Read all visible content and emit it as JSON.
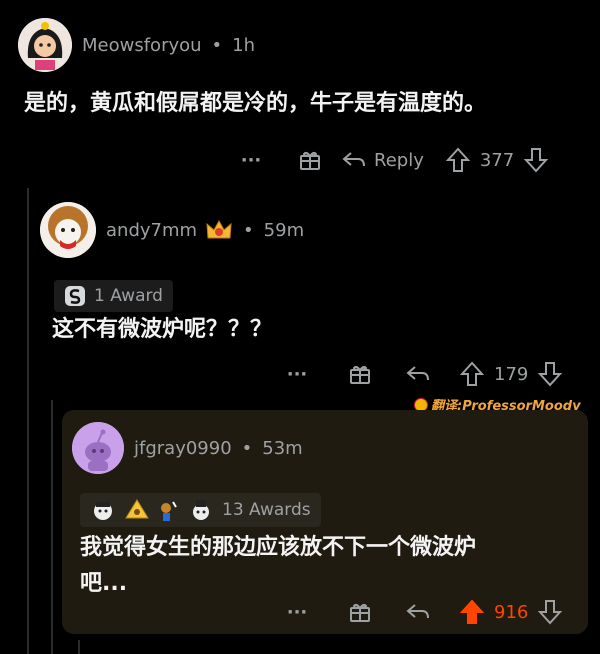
{
  "comments": [
    {
      "username": "Meowsforyou",
      "time": "1h",
      "text": "是的，黄瓜和假屌都是冷的，牛子是有温度的。",
      "actions": {
        "more": "···",
        "reply_label": "Reply",
        "score": "377"
      }
    },
    {
      "username": "andy7mm",
      "time": "59m",
      "award_label": "1 Award",
      "text": "这不有微波炉呢？？？",
      "actions": {
        "more": "···",
        "score": "179"
      }
    },
    {
      "username": "jfgray0990",
      "time": "53m",
      "award_label": "13 Awards",
      "text_line1": "我觉得女生的那边应该放不下一个微波炉",
      "text_line2": "吧...",
      "actions": {
        "more": "···",
        "score": "916"
      }
    }
  ],
  "separator": "•",
  "watermark": "翻译:ProfessorMoody",
  "colors": {
    "accent_upvote": "#ff4500",
    "highlight_bg": "#1f1b11",
    "muted": "#9ea1a3"
  }
}
